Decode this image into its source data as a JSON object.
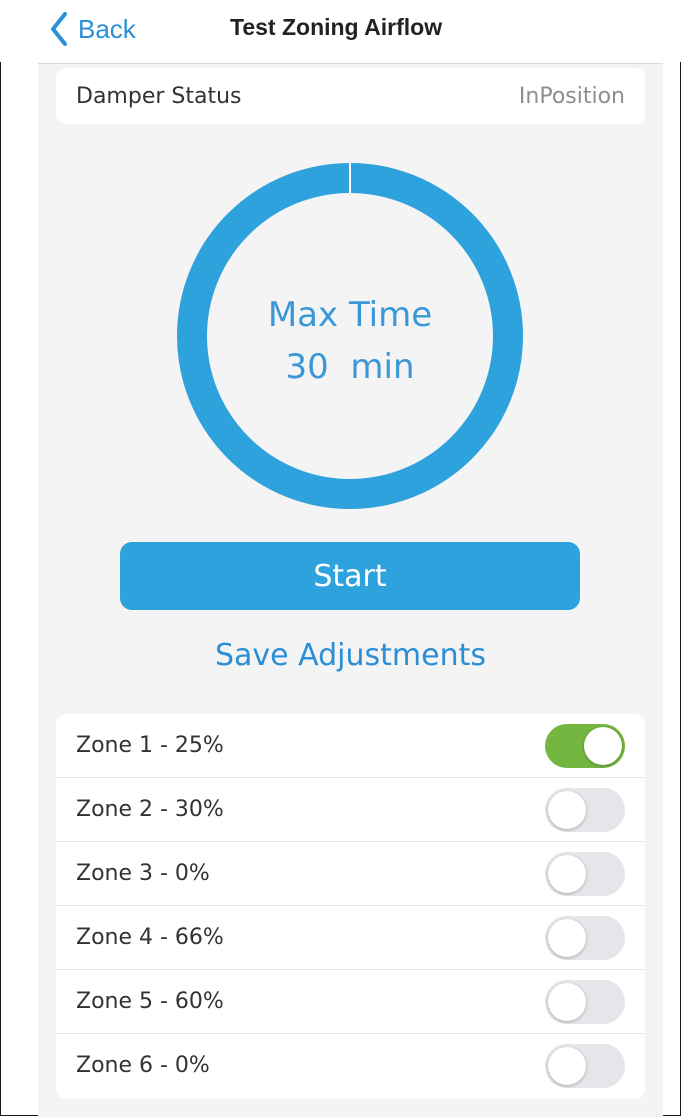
{
  "nav": {
    "back_label": "Back",
    "title": "Test Zoning Airflow"
  },
  "damper": {
    "label": "Damper Status",
    "value": "InPosition"
  },
  "timer": {
    "line1": "Max Time",
    "line2": "30  min",
    "progress": 1.0,
    "ring_color": "#2ea2dc"
  },
  "actions": {
    "start_label": "Start",
    "save_label": "Save Adjustments"
  },
  "zones": [
    {
      "label": "Zone 1 - 25%",
      "on": true
    },
    {
      "label": "Zone 2 - 30%",
      "on": false
    },
    {
      "label": "Zone 3 - 0%",
      "on": false
    },
    {
      "label": "Zone 4 - 66%",
      "on": false
    },
    {
      "label": "Zone 5 - 60%",
      "on": false
    },
    {
      "label": "Zone 6 - 0%",
      "on": false
    }
  ],
  "colors": {
    "accent": "#2ea2dc",
    "toggle_on": "#74b640"
  }
}
